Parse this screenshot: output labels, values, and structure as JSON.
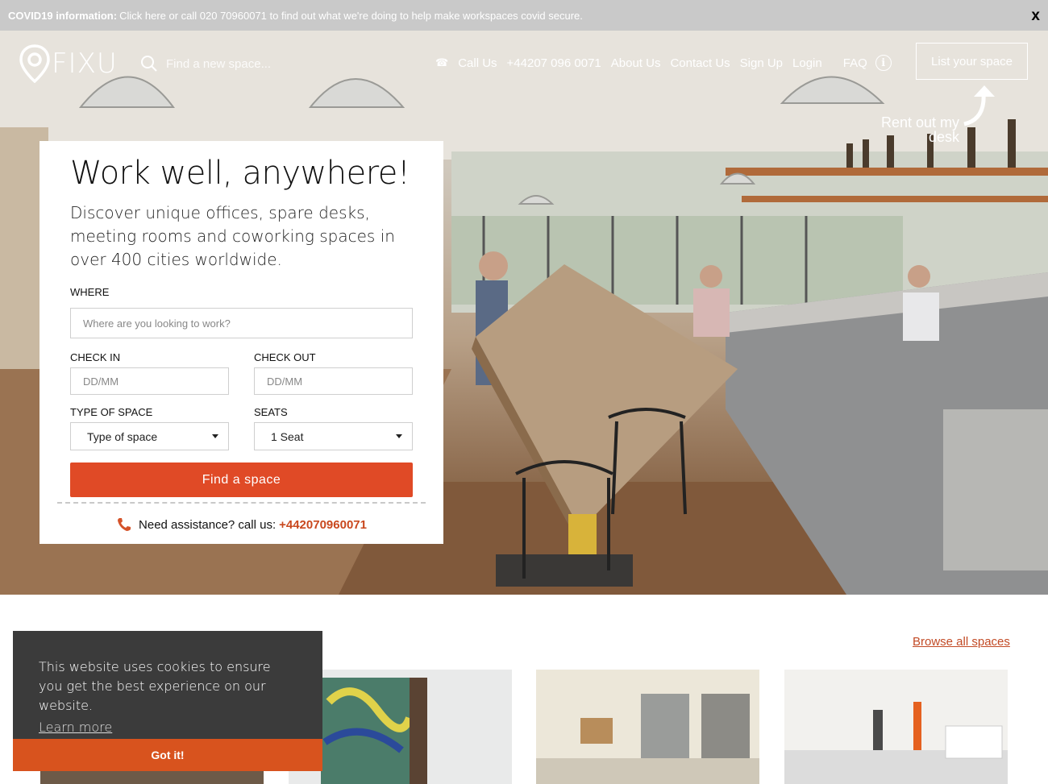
{
  "covid": {
    "label": "COVID19 information:",
    "text": "Click here or call 020 70960071 to find out what we're doing to help make workspaces covid secure.",
    "close": "x"
  },
  "brand": {
    "name": "FIXU"
  },
  "search": {
    "placeholder": "Find a new space..."
  },
  "nav": {
    "call_label": "Call Us",
    "phone": "+44207 096 0071",
    "about": "About Us",
    "contact": "Contact Us",
    "signup": "Sign Up",
    "login": "Login",
    "faq": "FAQ",
    "info_symbol": "i"
  },
  "list_space": {
    "button": "List your space",
    "note": "Rent out my desk"
  },
  "card": {
    "title": "Work well, anywhere!",
    "lead": "Discover unique offices, spare desks, meeting rooms and coworking spaces in over 400 cities worldwide.",
    "where_label": "WHERE",
    "where_placeholder": "Where are you looking to work?",
    "checkin_label": "CHECK IN",
    "checkin_placeholder": "DD/MM",
    "checkout_label": "CHECK OUT",
    "checkout_placeholder": "DD/MM",
    "type_label": "TYPE OF SPACE",
    "type_value": "Type of space",
    "seats_label": "SEATS",
    "seats_value": "1 Seat",
    "find_button": "Find a space",
    "assist_text": "Need assistance? call us:",
    "assist_number": "+442070960071"
  },
  "listings": {
    "browse_all": "Browse all spaces"
  },
  "cookie": {
    "message": "This website uses cookies to ensure you get the best experience on our website.",
    "learn_more": "Learn more",
    "accept": "Got it!"
  },
  "colors": {
    "accent": "#e04a26",
    "banner": "#c9c9c9",
    "cookie_bg": "#3b3b3b",
    "cookie_btn": "#d8531e"
  },
  "icons": [
    "map-pin-logo-icon",
    "search-icon",
    "phone-icon",
    "info-icon",
    "curved-arrow-icon",
    "phone-handset-icon",
    "chevron-down-icon"
  ]
}
